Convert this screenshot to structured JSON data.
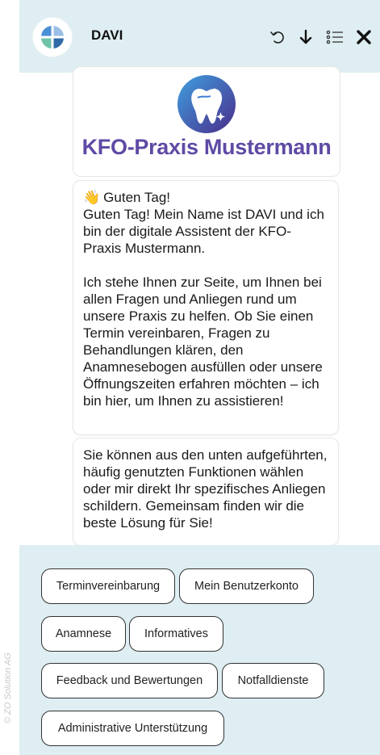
{
  "watermark": "© ZO Solution AG",
  "header": {
    "title": "DAVI"
  },
  "logo": {
    "text": "KFO-Praxis Mustermann"
  },
  "messages": [
    {
      "emoji": "👋",
      "title": "Guten Tag!",
      "para1": "Guten Tag! Mein Name ist DAVI und ich bin der digitale Assistent der KFO-Praxis Mustermann.",
      "para2": "Ich stehe Ihnen zur Seite, um Ihnen bei allen Fragen und Anliegen rund um unsere Praxis zu helfen. Ob Sie einen Termin vereinbaren, Fragen zu Behandlungen klären, den Anamnesebogen ausfüllen oder unsere Öffnungszeiten erfahren möchten – ich bin hier, um Ihnen zu assistieren!"
    },
    {
      "text": "Sie können aus den unten aufgeführten, häufig genutzten Funktionen wählen oder mir direkt Ihr spezifisches Anliegen schildern. Gemeinsam finden wir die beste Lösung für Sie!"
    }
  ],
  "quick_replies": [
    "Terminvereinbarung",
    "Mein Benutzerkonto",
    "Anamnese",
    "Informatives",
    "Feedback und Bewertungen",
    "Notfalldienste",
    "Administrative Unterstützung"
  ],
  "icons": {
    "avatar": "davi-logo-icon",
    "undo": "undo-icon",
    "download": "download-icon",
    "menu": "list-menu-icon",
    "close": "close-icon"
  },
  "colors": {
    "header_bg": "#deeef2",
    "brand_purple": "#5f4aa5",
    "tooth_gradient_start": "#3fa0e0",
    "tooth_gradient_end": "#4a2c8a"
  }
}
